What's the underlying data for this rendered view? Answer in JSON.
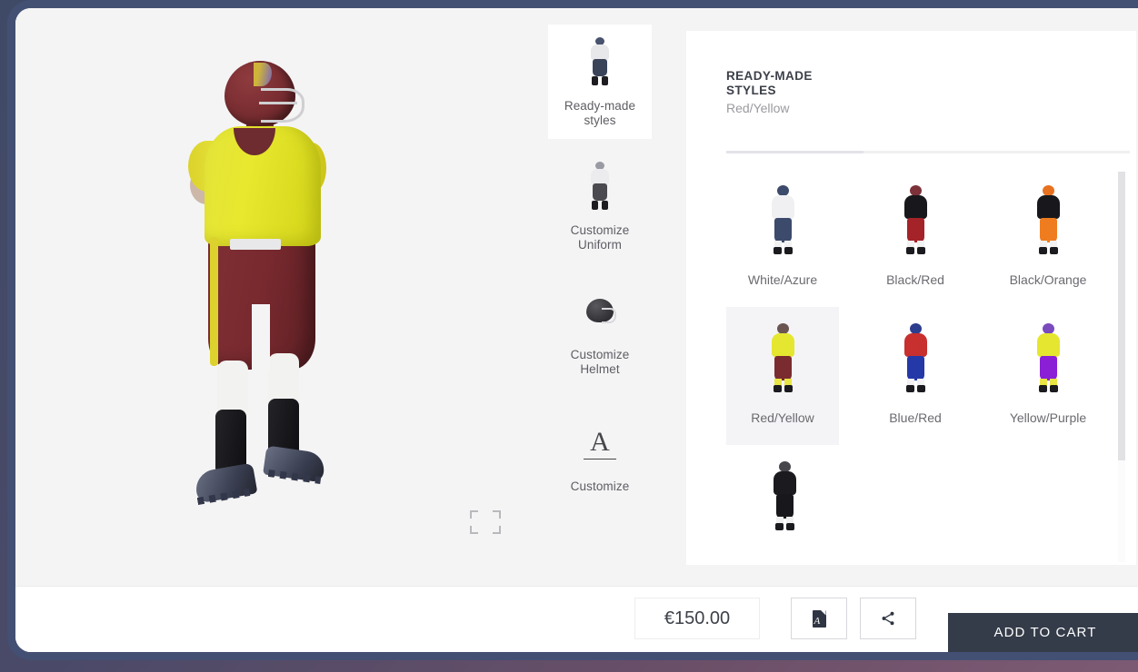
{
  "viewer": {
    "fullscreen_icon": "fullscreen-expand-icon",
    "model_description": "Football player 3D preview",
    "model_colors": {
      "jersey": "#e5e630",
      "pants": "#7a2b30",
      "helmet": "#7c2f33",
      "socks": "#f2f2f0",
      "cleats": "#2b2f3d",
      "stripe": "#ddd12e"
    }
  },
  "sidebar": {
    "items": [
      {
        "label": "Ready-made styles",
        "icon": "player-figure-icon",
        "active": true,
        "colors": {
          "head": "#49536e",
          "torso": "#e8e8ea",
          "legs": "#3a4459"
        }
      },
      {
        "label": "Customize Uniform",
        "icon": "player-figure-icon",
        "active": false,
        "colors": {
          "head": "#9a9aa2",
          "torso": "#ececee",
          "legs": "#4a4a50"
        }
      },
      {
        "label": "Customize Helmet",
        "icon": "helmet-icon",
        "active": false
      },
      {
        "label": "Customize",
        "icon": "letter-a-icon",
        "active": false,
        "glyph": "A"
      }
    ]
  },
  "panel": {
    "title": "READY-MADE STYLES",
    "subtitle": "Red/Yellow",
    "progress_percent": 34,
    "rows": [
      [
        {
          "label": "White/Azure",
          "selected": false,
          "colors": {
            "head": "#3c4a6b",
            "torso": "#f0f0f2",
            "legs": "#3c4a6b",
            "socks": "#f2f2f2"
          }
        },
        {
          "label": "Black/Red",
          "selected": false,
          "colors": {
            "head": "#7c3238",
            "torso": "#18181c",
            "legs": "#a42329",
            "socks": "#f2f2f2"
          }
        },
        {
          "label": "Black/Orange",
          "selected": false,
          "colors": {
            "head": "#e8711f",
            "torso": "#18181c",
            "legs": "#ef7d1f",
            "socks": "#f2f2f2"
          }
        }
      ],
      [
        {
          "label": "Red/Yellow",
          "selected": true,
          "colors": {
            "head": "#6b5550",
            "torso": "#e5e630",
            "legs": "#7a2b30",
            "socks": "#e9e545"
          }
        },
        {
          "label": "Blue/Red",
          "selected": false,
          "colors": {
            "head": "#2d3d8e",
            "torso": "#c7302f",
            "legs": "#2438a8",
            "socks": "#f2f2f2"
          }
        },
        {
          "label": "Yellow/Purple",
          "selected": false,
          "colors": {
            "head": "#7b4bbd",
            "torso": "#e5e630",
            "legs": "#8a1fd6",
            "socks": "#e9e545"
          }
        }
      ],
      [
        {
          "label": "",
          "selected": false,
          "colors": {
            "head": "#46464c",
            "torso": "#1b1b1f",
            "legs": "#18181c",
            "socks": "#f0f0f0"
          }
        }
      ]
    ],
    "scrollbar": {
      "thumb_percent": 74
    }
  },
  "bottom_bar": {
    "price": "€150.00",
    "pdf_label": "pdf-document-icon",
    "share_label": "share-icon",
    "add_to_cart_label": "ADD TO CART"
  },
  "colors": {
    "frame": "#435073",
    "page_bg": "#f4f4f5",
    "panel_bg": "#ffffff",
    "accent_dark": "#343b49",
    "text_muted": "#9a9aa0"
  }
}
